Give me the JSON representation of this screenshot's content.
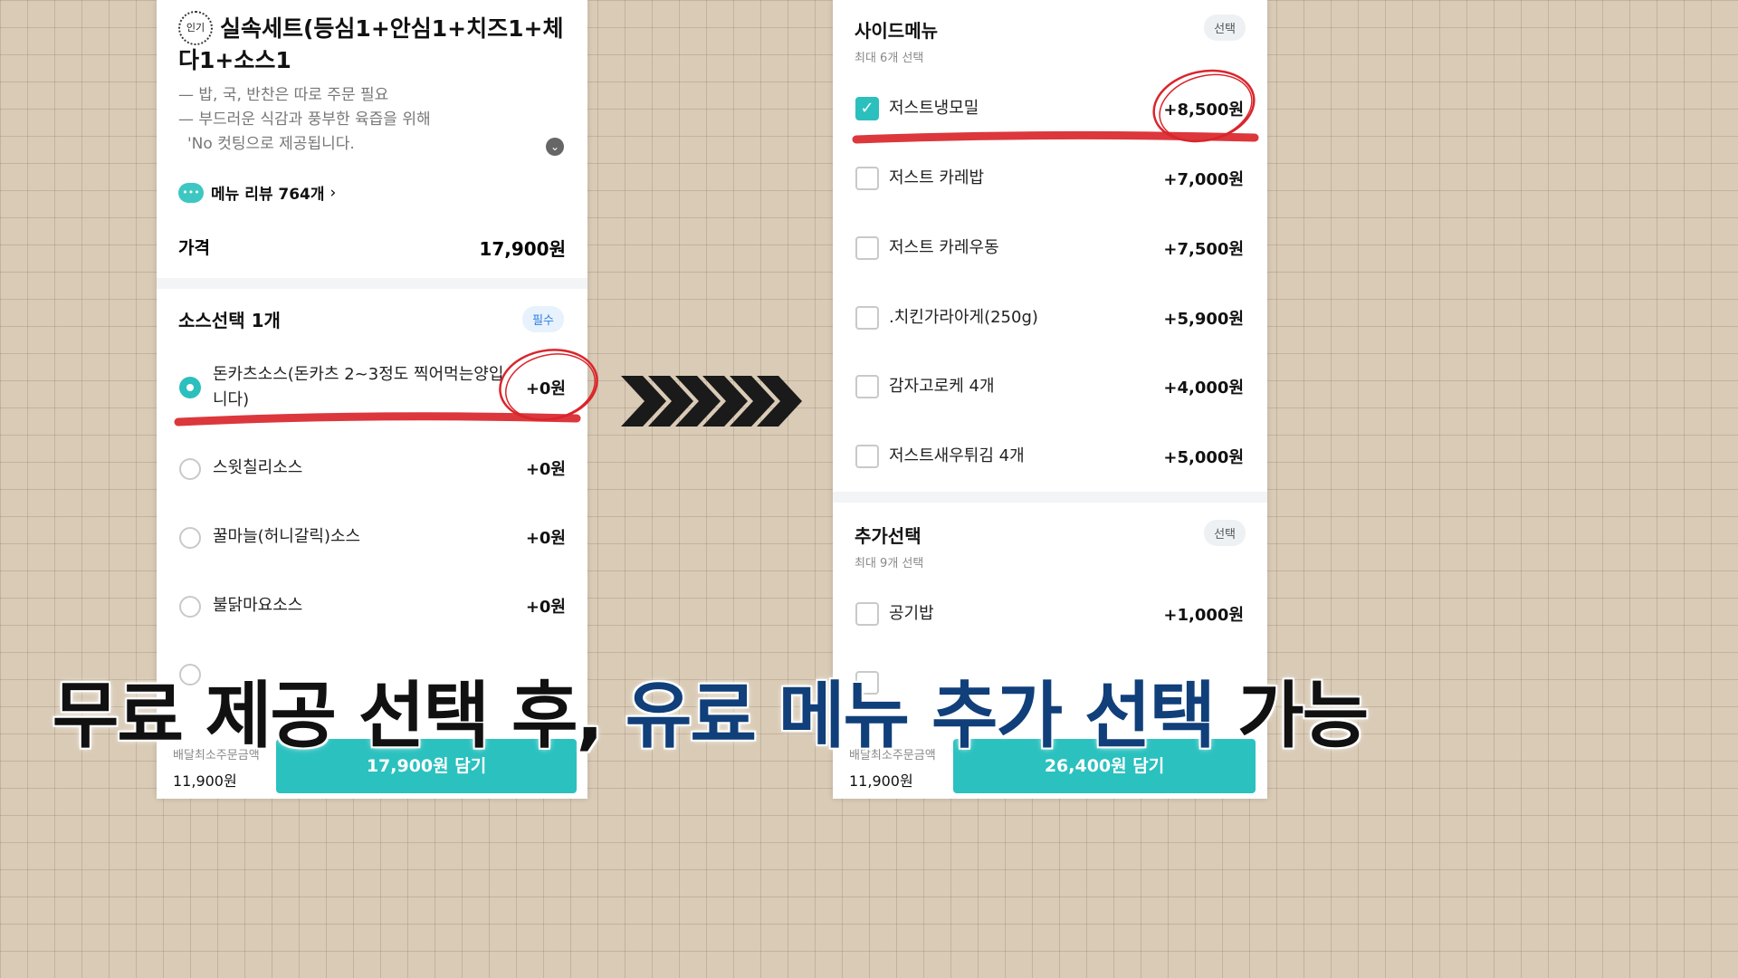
{
  "left": {
    "popular_badge": "인기",
    "title": "실속세트(등심1+안심1+치즈1+체다1+소스1",
    "desc_lines": [
      "— 밥, 국, 반찬은 따로 주문 필요",
      "— 부드러운 식감과 풍부한 육즙을 위해",
      "'No 컷팅으로 제공됩니다."
    ],
    "review_link": "메뉴 리뷰 764개",
    "price_label": "가격",
    "price_value": "17,900원",
    "sauce_section": {
      "title": "소스선택 1개",
      "badge": "필수",
      "options": [
        {
          "label": "돈카츠소스(돈카츠 2~3정도 찍어먹는양입니다)",
          "price": "+0원",
          "selected": true
        },
        {
          "label": "스윗칠리소스",
          "price": "+0원",
          "selected": false
        },
        {
          "label": "꿀마늘(허니갈릭)소스",
          "price": "+0원",
          "selected": false
        },
        {
          "label": "불닭마요소스",
          "price": "+0원",
          "selected": false
        }
      ]
    },
    "min_order_label": "배달최소주문금액",
    "min_order_value": "11,900원",
    "cta": "17,900원 담기"
  },
  "right": {
    "side_section": {
      "title": "사이드메뉴",
      "badge": "선택",
      "sub": "최대 6개 선택",
      "options": [
        {
          "label": "저스트냉모밀",
          "price": "+8,500원",
          "checked": true
        },
        {
          "label": "저스트 카레밥",
          "price": "+7,000원",
          "checked": false
        },
        {
          "label": "저스트 카레우동",
          "price": "+7,500원",
          "checked": false
        },
        {
          "label": ".치킨가라아게(250g)",
          "price": "+5,900원",
          "checked": false
        },
        {
          "label": "감자고로케 4개",
          "price": "+4,000원",
          "checked": false
        },
        {
          "label": "저스트새우튀김 4개",
          "price": "+5,000원",
          "checked": false
        }
      ]
    },
    "extra_section": {
      "title": "추가선택",
      "badge": "선택",
      "sub": "최대 9개 선택",
      "options": [
        {
          "label": "공기밥",
          "price": "+1,000원",
          "checked": false
        }
      ]
    },
    "min_order_label": "배달최소주문금액",
    "min_order_value": "11,900원",
    "cta": "26,400원 담기"
  },
  "caption": {
    "part1": "무료 제공 선택 후,",
    "part2": "유료 메뉴 추가 선택",
    "part3": "가능"
  },
  "colors": {
    "teal": "#2bc1bf",
    "highlight_red": "#d9262b",
    "caption_blue": "#103f7a"
  }
}
